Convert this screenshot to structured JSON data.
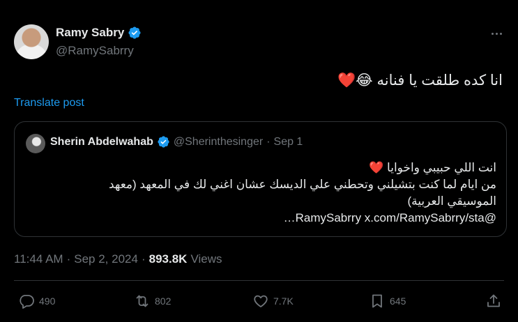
{
  "author": {
    "name": "Ramy Sabry",
    "handle": "@RamySabrry"
  },
  "tweet": {
    "text": "انا كده طلقت يا فنانه 😂❤️",
    "translate_label": "Translate post"
  },
  "quoted": {
    "name": "Sherin Abdelwahab",
    "handle": "@Sherinthesinger",
    "separator": "·",
    "date": "Sep 1",
    "lines": [
      "انت اللي حبيبي واخوايا ❤️",
      "من ايام لما كنت بتشيلني وتحطني علي الديسك عشان اغني لك في المعهد (معهد",
      "الموسيقي العربية)",
      "@RamySabrry x.com/RamySabrry/sta…"
    ]
  },
  "meta": {
    "time": "11:44 AM",
    "separator": "·",
    "date": "Sep 2, 2024",
    "separator2": "·",
    "views_count": "893.8K",
    "views_label": "Views"
  },
  "actions": {
    "replies": "490",
    "reposts": "802",
    "likes": "7.7K",
    "bookmarks": "645"
  },
  "colors": {
    "background": "#000000",
    "accent": "#1d9bf0",
    "muted": "#71767b",
    "border": "#2f3336"
  },
  "icons": [
    "verified-badge-icon",
    "more-icon",
    "reply-icon",
    "repost-icon",
    "like-icon",
    "bookmark-icon",
    "share-icon"
  ]
}
